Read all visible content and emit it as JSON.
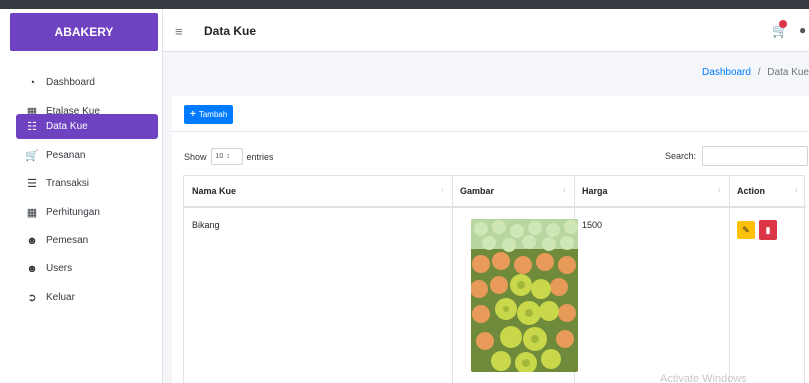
{
  "app": {
    "brand": "ABAKERY"
  },
  "sidebar": {
    "items": [
      {
        "label": "Dashboard",
        "icon": "dashboard-icon",
        "active": false
      },
      {
        "label": "Etalase Kue",
        "icon": "grid-icon",
        "active": false
      },
      {
        "label": "Data Kue",
        "icon": "database-icon",
        "active": true
      },
      {
        "label": "Pesanan",
        "icon": "cart-icon",
        "active": false
      },
      {
        "label": "Transaksi",
        "icon": "list-icon",
        "active": false
      },
      {
        "label": "Perhitungan",
        "icon": "calculator-icon",
        "active": false
      },
      {
        "label": "Pemesan",
        "icon": "users-icon",
        "active": false
      },
      {
        "label": "Users",
        "icon": "users-icon",
        "active": false
      },
      {
        "label": "Keluar",
        "icon": "sign-out-icon",
        "active": false
      }
    ]
  },
  "header": {
    "title": "Data Kue",
    "icons": [
      "hamburger-icon",
      "cart-icon",
      "user-icon"
    ]
  },
  "breadcrumb": {
    "home": "Dashboard",
    "separator": "/",
    "current": "Data Kue"
  },
  "toolbar": {
    "add_label": "Tambah",
    "add_icon": "plus-icon"
  },
  "table_controls": {
    "show_label": "Show",
    "entries_value": "10",
    "entries_label": "entries",
    "search_label": "Search:",
    "search_value": ""
  },
  "table": {
    "columns": [
      "Nama Kue",
      "Gambar",
      "Harga",
      "Action"
    ],
    "rows": [
      {
        "nama": "Bikang",
        "gambar": "cake-photo",
        "harga": "1500",
        "actions": [
          "edit-icon",
          "trash-icon"
        ]
      }
    ]
  },
  "watermark": "Activate Windows",
  "colors": {
    "accent": "#6f42c1",
    "primary": "#007bff",
    "warning": "#ffc107",
    "danger": "#dc3545"
  }
}
